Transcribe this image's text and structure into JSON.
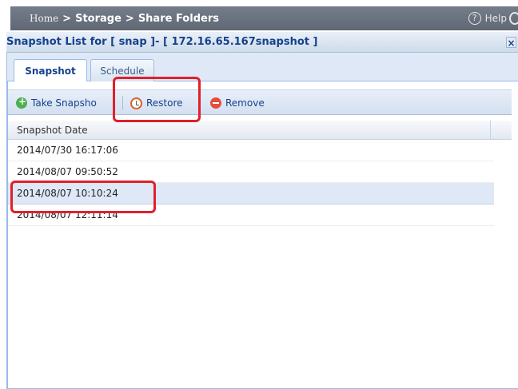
{
  "breadcrumb": {
    "home": "Home",
    "separator": ">",
    "storage": "Storage",
    "share_folders": "Share Folders"
  },
  "help": {
    "label": "Help",
    "icon": "question-icon"
  },
  "dialog": {
    "title": "Snapshot List for [ snap ]- [ 172.16.65.167snapshot ]",
    "close_label": "×"
  },
  "tabs": [
    {
      "label": "Snapshot",
      "active": true
    },
    {
      "label": "Schedule",
      "active": false
    }
  ],
  "toolbar": {
    "take_snapshot": "Take Snapsho",
    "restore": "Restore",
    "remove": "Remove"
  },
  "grid": {
    "column_header": "Snapshot Date",
    "rows": [
      {
        "date": "2014/07/30 16:17:06",
        "selected": false
      },
      {
        "date": "2014/08/07 09:50:52",
        "selected": false
      },
      {
        "date": "2014/08/07 10:10:24",
        "selected": true
      },
      {
        "date": "2014/08/07 12:11:14",
        "selected": false
      }
    ]
  },
  "colors": {
    "highlight": "#e0202a",
    "title_text": "#15428b",
    "breadcrumb_bg": "#6b7480"
  }
}
